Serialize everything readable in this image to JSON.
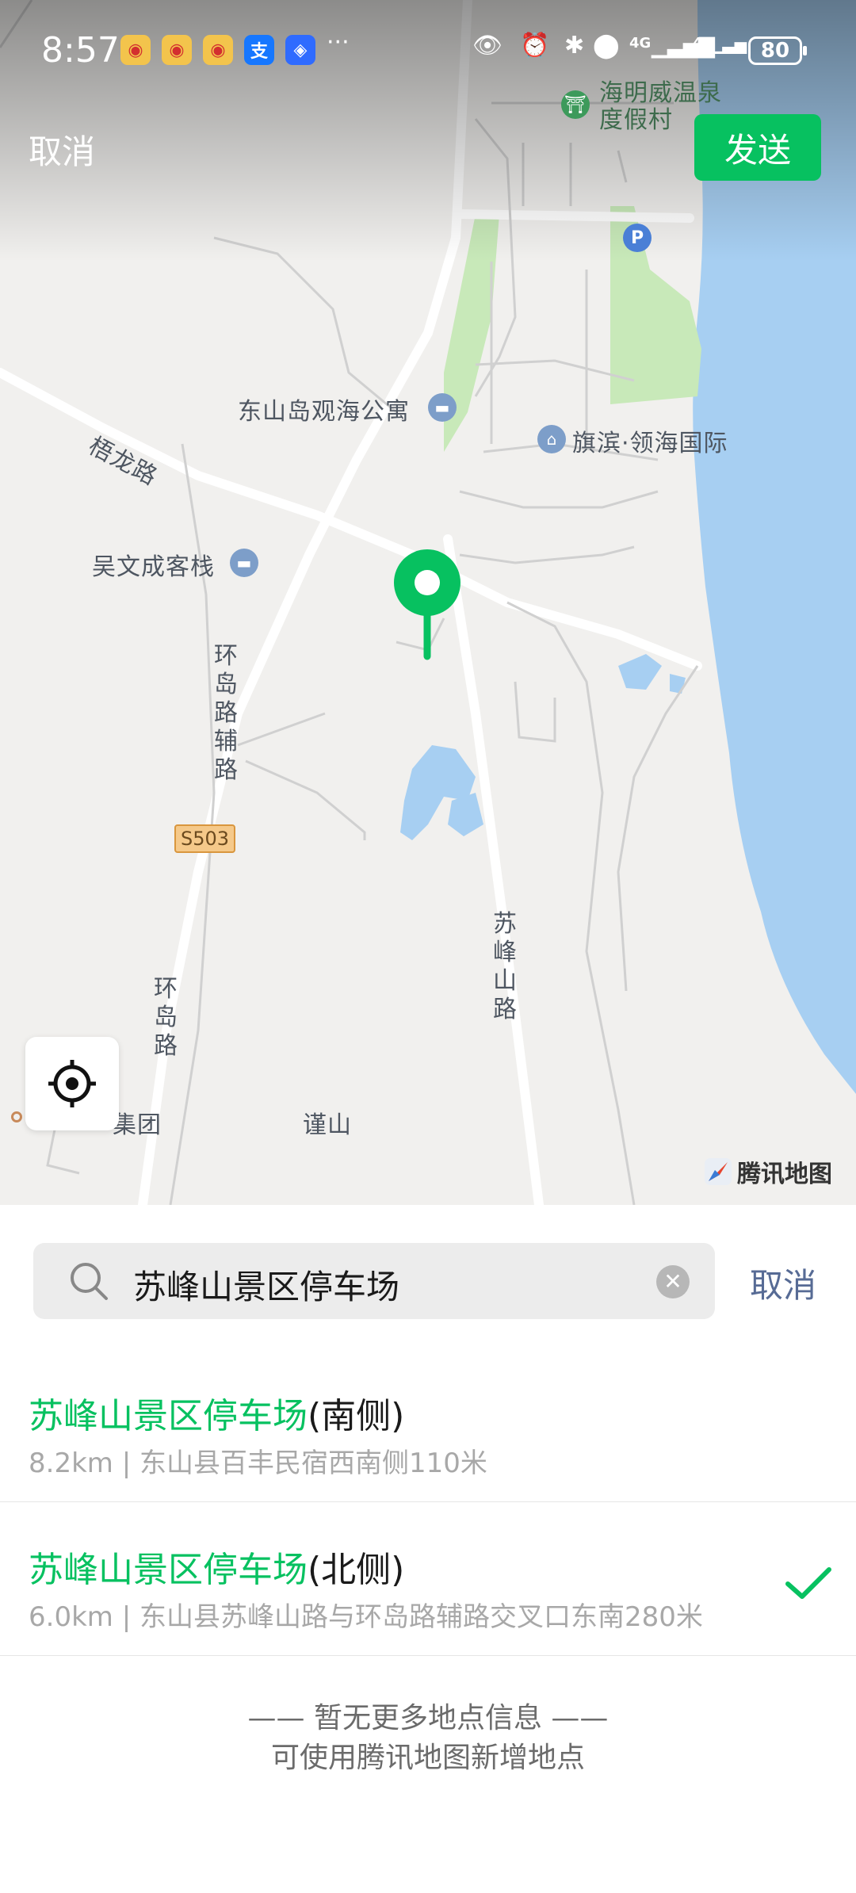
{
  "status_bar": {
    "time": "8:57",
    "more": "···",
    "battery": "80",
    "net1": "4G",
    "net2": "4G"
  },
  "header": {
    "cancel_label": "取消",
    "send_label": "发送"
  },
  "map": {
    "labels": {
      "resort_line1": "海明威温泉",
      "resort_line2": "度假村",
      "apartment": "东山岛观海公寓",
      "qibin": "旗滨·领海国际",
      "wulong_road": "梧龙路",
      "wuwencheng": "吴文成客栈",
      "aux_road": "环岛路辅路",
      "s503": "S503",
      "sufeng_road": "苏峰山路",
      "huandao_road": "环岛路",
      "group": "集团",
      "jinshan": "谨山",
      "tencent_map": "腾讯地图"
    },
    "colors": {
      "water": "#a7cff2",
      "park": "#c8e9b9",
      "pin": "#07c160"
    }
  },
  "search": {
    "query": "苏峰山景区停车场",
    "cancel_label": "取消"
  },
  "results": [
    {
      "name_highlight": "苏峰山景区停车场",
      "name_suffix": "(南侧)",
      "detail": "8.2km | 东山县百丰民宿西南侧110米",
      "selected": false
    },
    {
      "name_highlight": "苏峰山景区停车场",
      "name_suffix": "(北侧)",
      "detail": "6.0km | 东山县苏峰山路与环岛路辅路交叉口东南280米",
      "selected": true
    }
  ],
  "footer": {
    "line1": "—— 暂无更多地点信息 ——",
    "line2": "可使用腾讯地图新增地点"
  }
}
